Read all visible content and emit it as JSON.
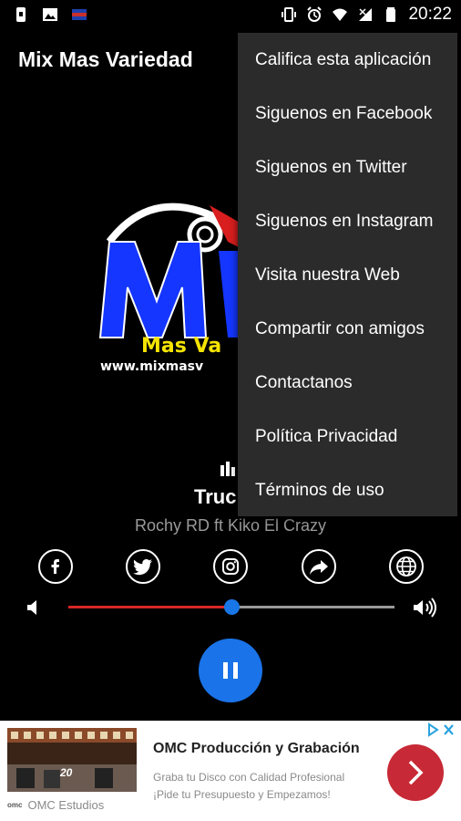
{
  "status_bar": {
    "time": "20:22",
    "left_icons": [
      "notification-icon",
      "image-icon",
      "flag-icon"
    ],
    "right_icons": [
      "vibrate-icon",
      "alarm-icon",
      "wifi-icon",
      "signal-icon",
      "battery-icon"
    ]
  },
  "toolbar": {
    "title": "Mix Mas Variedad"
  },
  "logo": {
    "letters": "M",
    "line1": "Mas Va",
    "line2": "www.mixmasv"
  },
  "player": {
    "title_partial": "Truc",
    "artist": "Rochy RD ft Kiko El Crazy",
    "volume_fraction": 0.5,
    "state": "playing"
  },
  "social": [
    {
      "name": "facebook-icon"
    },
    {
      "name": "twitter-icon"
    },
    {
      "name": "instagram-icon"
    },
    {
      "name": "share-icon"
    },
    {
      "name": "web-icon"
    }
  ],
  "menu": {
    "items": [
      {
        "label": "Califica esta aplicación"
      },
      {
        "label": "Siguenos en Facebook"
      },
      {
        "label": "Siguenos en Twitter"
      },
      {
        "label": "Siguenos en Instagram"
      },
      {
        "label": "Visita nuestra Web"
      },
      {
        "label": "Compartir con amigos"
      },
      {
        "label": "Contactanos"
      },
      {
        "label": "Política Privacidad"
      },
      {
        "label": "Términos de uso"
      }
    ]
  },
  "ad": {
    "title": "OMC Producción y Grabación",
    "desc1": "Graba tu Disco con Calidad Profesional",
    "desc2": "¡Pide tu Presupuesto y Empezamos!",
    "brand": "OMC Estudios",
    "brand_logo": "omc",
    "image_caption": "20",
    "colors": {
      "cta": "#c72a36",
      "choices": "#2aa3e0"
    }
  },
  "colors": {
    "accent": "#1a73e8",
    "seek_fill": "#d72626",
    "menu_bg": "#2b2b2b"
  }
}
